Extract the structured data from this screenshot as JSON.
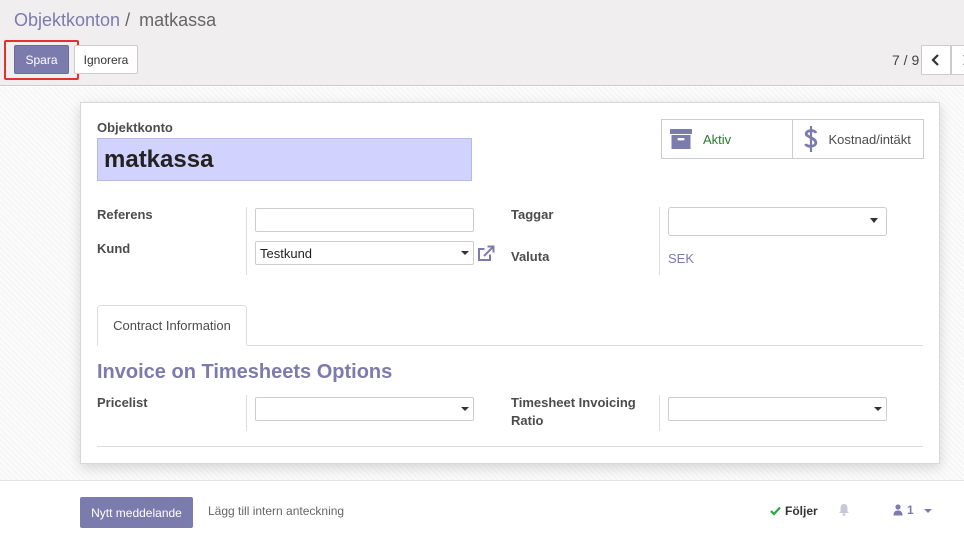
{
  "breadcrumb": {
    "parent": "Objektkonton",
    "separator": "/",
    "current": "matkassa"
  },
  "buttons": {
    "save": "Spara",
    "discard": "Ignorera"
  },
  "pager": {
    "value": "7 / 9"
  },
  "form": {
    "name_label": "Objektkonto",
    "name_value": "matkassa",
    "smart_buttons": {
      "active": "Aktiv",
      "cost_revenue": "Kostnad/intäkt"
    },
    "reference_label": "Referens",
    "reference_value": "",
    "customer_label": "Kund",
    "customer_value": "Testkund",
    "tags_label": "Taggar",
    "tags_value": "",
    "currency_label": "Valuta",
    "currency_value": "SEK",
    "tab_label": "Contract Information",
    "section_title": "Invoice on Timesheets Options",
    "pricelist_label": "Pricelist",
    "pricelist_value": "",
    "invoicing_ratio_label_1": "Timesheet Invoicing",
    "invoicing_ratio_label_2": "Ratio",
    "invoicing_ratio_value": ""
  },
  "chatter": {
    "new_message": "Nytt meddelande",
    "log_note": "Lägg till intern anteckning",
    "following": "Följer",
    "followers_count": "1"
  },
  "colors": {
    "primary": "#7c7bad",
    "highlight": "#e53030",
    "active_green": "#2b7a2b",
    "name_field_bg": "#d2d2ff"
  },
  "icons": {
    "archive": "archive-icon",
    "dollar": "dollar-icon",
    "external_link": "external-link-icon",
    "bell": "bell-icon",
    "user": "user-icon",
    "check": "check-icon"
  }
}
